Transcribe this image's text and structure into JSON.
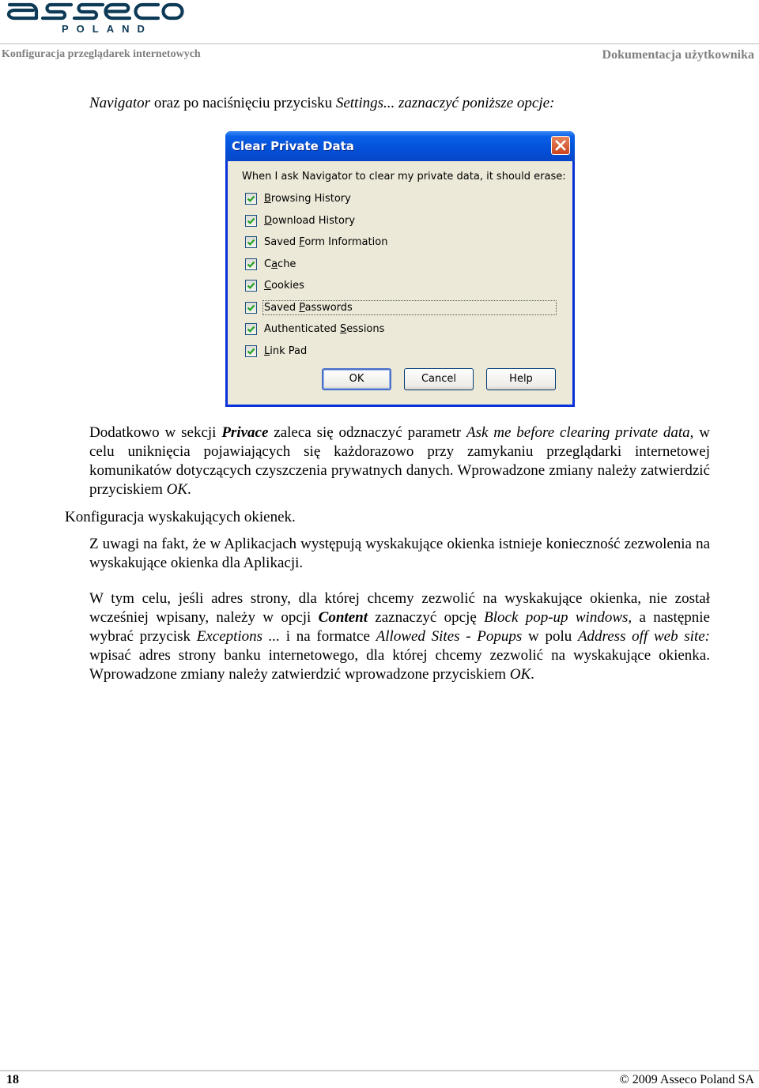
{
  "header": {
    "logo_text": "asseco",
    "logo_sub": "POLAND",
    "left_title": "Konfiguracja przeglądarek internetowych",
    "right_title": "Dokumentacja użytkownika"
  },
  "intro": {
    "navigator": "Navigator",
    "text1": " oraz po naciśnięciu przycisku ",
    "settings": "Settings... zaznaczyć poniższe opcje:"
  },
  "dialog": {
    "title": "Clear Private Data",
    "prompt": "When I ask Navigator to clear my private data, it should erase:",
    "options": [
      {
        "pre": "",
        "key": "B",
        "post": "rowsing History",
        "checked": true
      },
      {
        "pre": "",
        "key": "D",
        "post": "ownload History",
        "checked": true
      },
      {
        "pre": "Saved ",
        "key": "F",
        "post": "orm Information",
        "checked": true
      },
      {
        "pre": "C",
        "key": "a",
        "post": "che",
        "checked": true
      },
      {
        "pre": "",
        "key": "C",
        "post": "ookies",
        "checked": true
      },
      {
        "pre": "Saved ",
        "key": "P",
        "post": "asswords",
        "checked": true
      },
      {
        "pre": "Authenticated ",
        "key": "S",
        "post": "essions",
        "checked": true
      },
      {
        "pre": "",
        "key": "L",
        "post": "ink Pad",
        "checked": true
      }
    ],
    "buttons": {
      "ok": "OK",
      "cancel": "Cancel",
      "help": "Help"
    }
  },
  "p1": {
    "t1": "Dodatkowo w sekcji ",
    "privace": "Privace",
    "t2": " zaleca się odznaczyć parametr ",
    "ask": "Ask me before clearing private data",
    "t3": ", w celu uniknięcia pojawiających się każdorazowo przy zamykaniu przeglądarki internetowej komunikatów dotyczących czyszczenia prywatnych danych.  Wprowadzone zmiany należy zatwierdzić przyciskiem ",
    "ok": "OK",
    "t4": "."
  },
  "heading_popups": "Konfiguracja wyskakujących okienek.",
  "p2": "Z uwagi na fakt, że w Aplikacjach występują wyskakujące okienka istnieje konieczność zezwolenia na wyskakujące okienka dla Aplikacji.",
  "p3": {
    "t1": "W tym celu, jeśli adres strony, dla której chcemy zezwolić na wyskakujące okienka, nie został wcześniej wpisany, należy w opcji ",
    "content": "Content",
    "t2": " zaznaczyć opcję ",
    "block": "Block pop-up windows,",
    "t3": " a następnie wybrać przycisk ",
    "exceptions": "Exceptions ...",
    "t4": " i na formatce ",
    "allowed": "Allowed Sites",
    "t5": " - ",
    "popups": "Popups",
    "t6": " w polu ",
    "address": "Address off web site:",
    "t7": " wpisać adres strony banku internetowego, dla której chcemy zezwolić na wyskakujące okienka. Wprowadzone zmiany należy zatwierdzić wprowadzone przyciskiem ",
    "ok": "OK",
    "t8": "."
  },
  "footer": {
    "page_number": "18",
    "copyright": "© 2009 Asseco Poland SA"
  },
  "colors": {
    "brand": "#0d3a57",
    "titlebar": "#0351d8",
    "dialog_bg": "#ece9d8",
    "check": "#21a121",
    "header_gray": "#808080"
  }
}
